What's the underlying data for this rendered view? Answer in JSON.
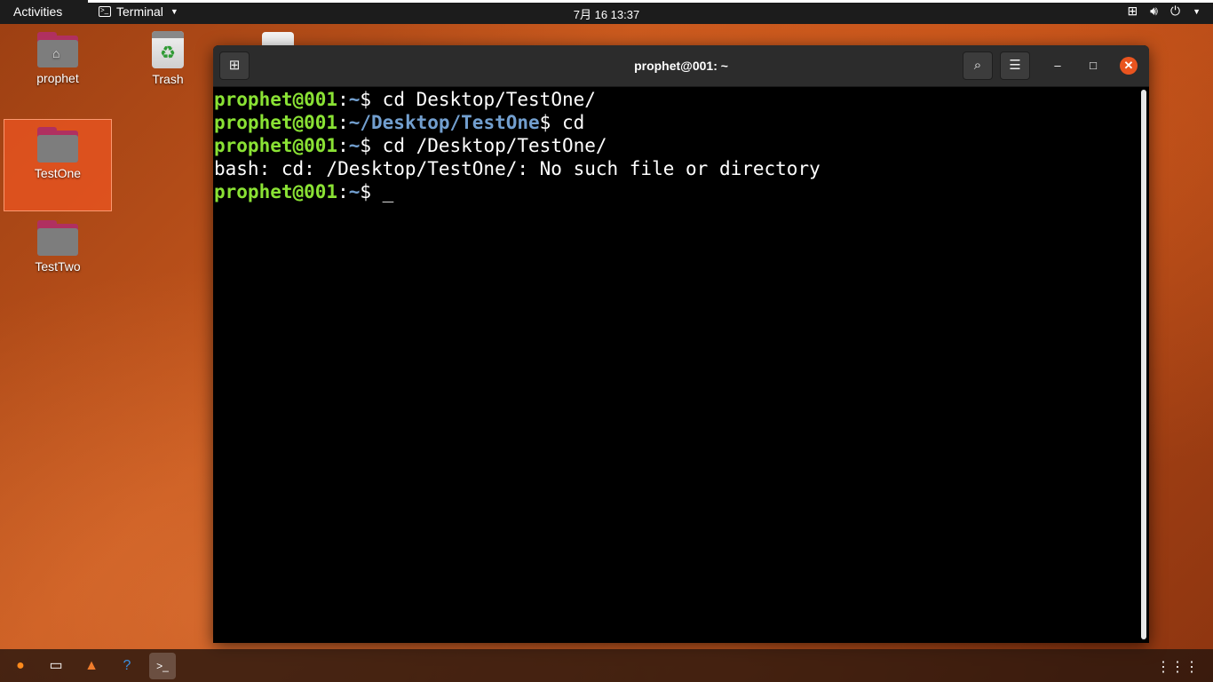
{
  "topbar": {
    "activities": "Activities",
    "app_name": "Terminal",
    "clock": "7月 16  13:37",
    "tray_icons": [
      "network-icon",
      "volume-icon",
      "power-icon"
    ]
  },
  "desktop": {
    "icons": [
      {
        "label": "prophet",
        "icon": "home-folder-icon"
      },
      {
        "label": "Trash",
        "icon": "trash-icon"
      },
      {
        "label": "TestOne",
        "icon": "folder-icon",
        "selected": true
      },
      {
        "label": "TestTwo",
        "icon": "folder-icon"
      }
    ]
  },
  "terminal": {
    "title": "prophet@001: ~",
    "lines": [
      {
        "user": "prophet@001",
        "sep": ":",
        "path": "~",
        "cmd": "$ cd Desktop/TestOne/"
      },
      {
        "user": "prophet@001",
        "sep": ":",
        "path": "~/Desktop/TestOne",
        "cmd": "$ cd"
      },
      {
        "user": "prophet@001",
        "sep": ":",
        "path": "~",
        "cmd": "$ cd /Desktop/TestOne/"
      },
      {
        "output": "bash: cd: /Desktop/TestOne/: No such file or directory"
      },
      {
        "user": "prophet@001",
        "sep": ":",
        "path": "~",
        "cmd": "$ _"
      }
    ]
  },
  "dock": {
    "apps": [
      "firefox-icon",
      "files-icon",
      "software-icon",
      "help-icon",
      "terminal-icon"
    ],
    "active_app": "terminal-icon"
  },
  "colors": {
    "accent": "#e9541f",
    "prompt_user": "#8ae234",
    "prompt_path": "#729fcf"
  }
}
